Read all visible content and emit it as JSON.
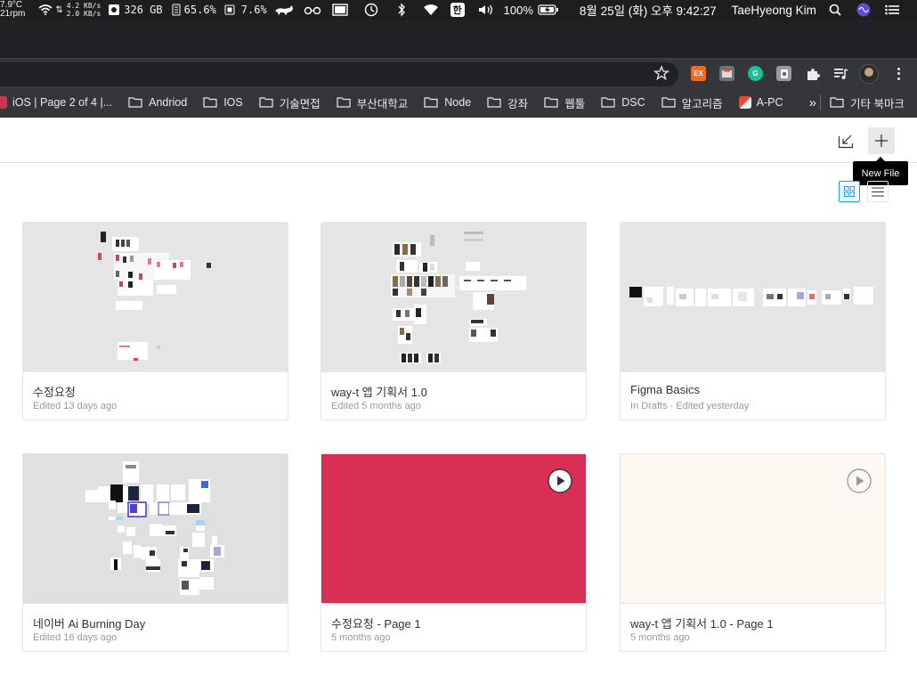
{
  "menubar": {
    "temp": "7.9°C",
    "fan": "21rpm",
    "net_up": "4.2 KB/s",
    "net_down": "2.0 KB/s",
    "disk": "326 GB",
    "memory": "65.6%",
    "cpu": "7.6%",
    "ime": "한",
    "battery": "100%",
    "datetime": "8월 25일 (화) 오후 9:42:27",
    "user": "TaeHyeong Kim"
  },
  "bookmarks": {
    "items": [
      {
        "label": "iOS | Page 2 of 4 |...",
        "icon": "site-favicon"
      },
      {
        "label": "Andriod",
        "icon": "folder-icon"
      },
      {
        "label": "IOS",
        "icon": "folder-icon"
      },
      {
        "label": "기술면접",
        "icon": "folder-icon"
      },
      {
        "label": "부산대학교",
        "icon": "folder-icon"
      },
      {
        "label": "Node",
        "icon": "folder-icon"
      },
      {
        "label": "강좌",
        "icon": "folder-icon"
      },
      {
        "label": "웹툴",
        "icon": "folder-icon"
      },
      {
        "label": "DSC",
        "icon": "folder-icon"
      },
      {
        "label": "알고리즘",
        "icon": "folder-icon"
      },
      {
        "label": "A-PC",
        "icon": "site-favicon"
      }
    ],
    "overflow": "»",
    "other": "기타 북마크"
  },
  "figma": {
    "tooltip": "New File",
    "files": [
      {
        "title": "수정요청",
        "subtitle": "Edited 13 days ago",
        "thumb_color": "#e5e5e5"
      },
      {
        "title": "way-t 앱 기획서 1.0",
        "subtitle": "Edited 5 months ago",
        "thumb_color": "#e5e5e5"
      },
      {
        "title": "Figma Basics",
        "subtitle": "In Drafts · Edited yesterday",
        "thumb_color": "#e5e5e5"
      },
      {
        "title": "네이버 Ai Burning Day",
        "subtitle": "Edited 16 days ago",
        "thumb_color": "#e0e0e0"
      },
      {
        "title": "수정요청 - Page 1",
        "subtitle": "5 months ago",
        "thumb_color": "#d92f55"
      },
      {
        "title": "way-t 앱 기획서 1.0 - Page 1",
        "subtitle": "5 months ago",
        "thumb_color": "#fdf9f2"
      }
    ]
  }
}
